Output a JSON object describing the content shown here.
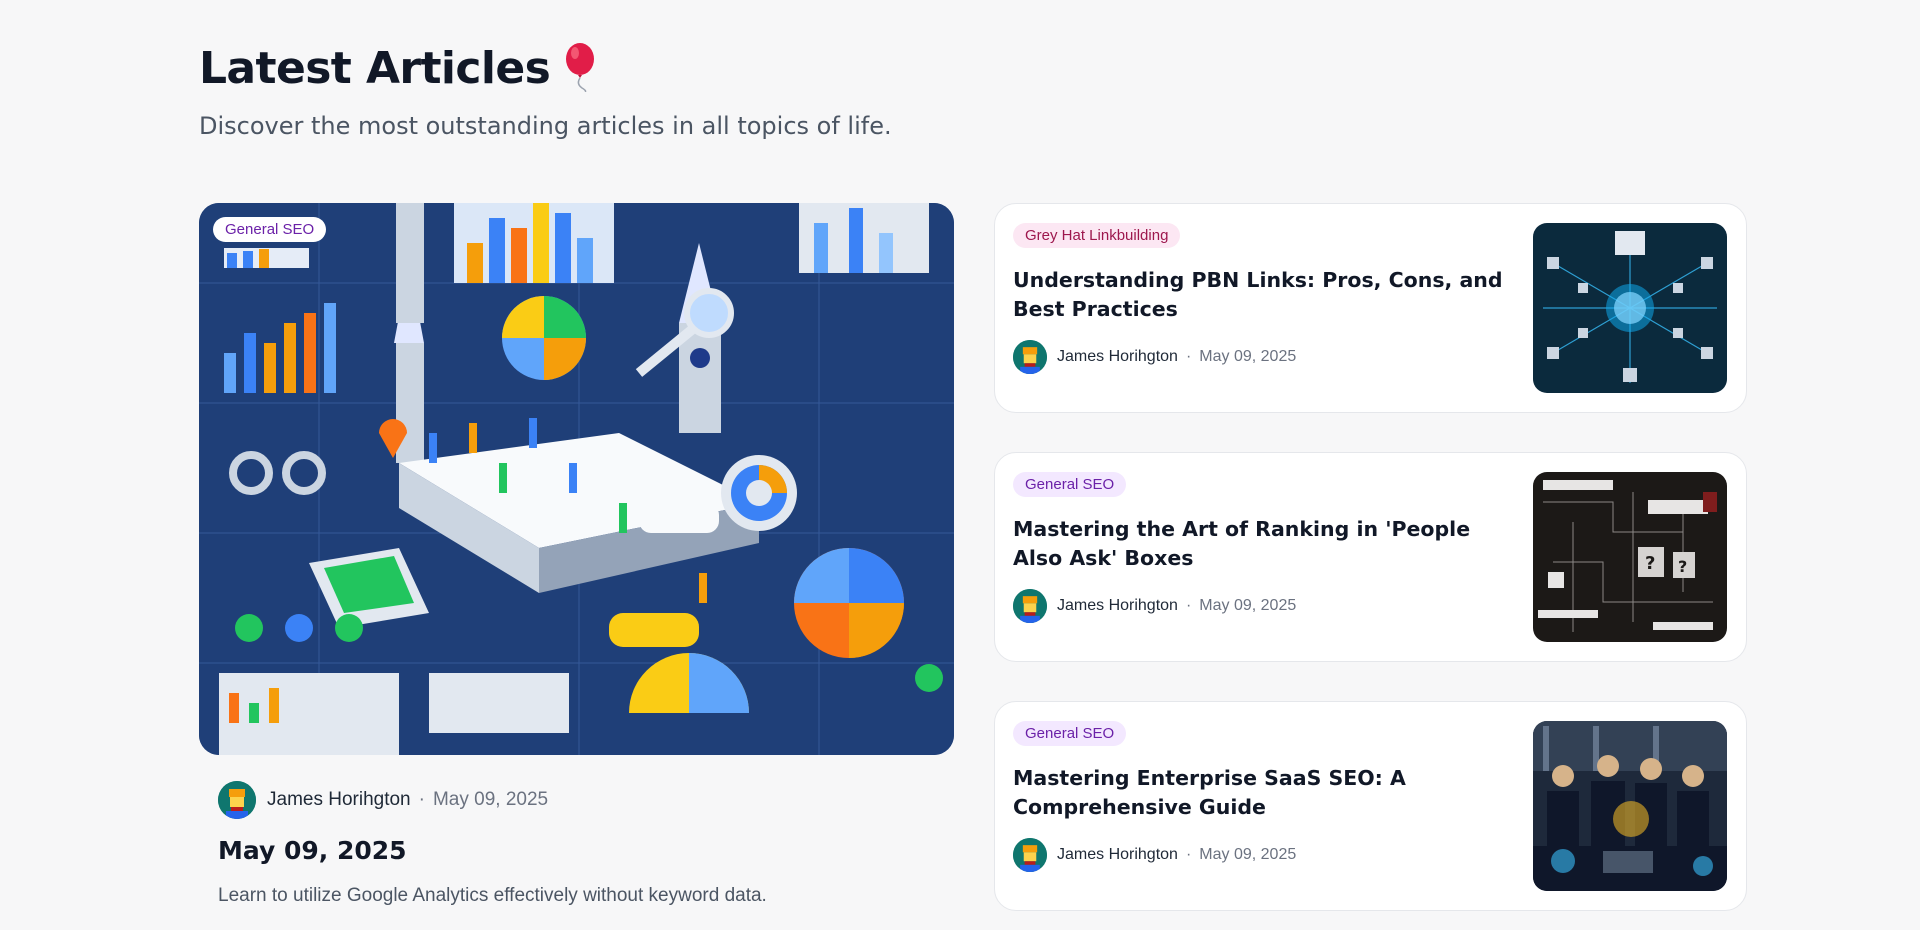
{
  "header": {
    "title": "Latest Articles",
    "subtitle": "Discover the most outstanding articles in all topics of life.",
    "emoji_icon": "balloon-icon"
  },
  "featured": {
    "category": "General SEO",
    "author": "James Horihgton",
    "date": "May 09, 2025",
    "title": "May 09, 2025",
    "description": "Learn to utilize Google Analytics effectively without keyword data.",
    "image_icon": "analytics-infographic-image"
  },
  "articles": [
    {
      "category": "Grey Hat Linkbuilding",
      "title": "Understanding PBN Links: Pros, Cons, and Best Practices",
      "author": "James Horihgton",
      "date": "May 09, 2025",
      "thumb": "network-cubes-image"
    },
    {
      "category": "General SEO",
      "title": "Mastering the Art of Ranking in 'People Also Ask' Boxes",
      "author": "James Horihgton",
      "date": "May 09, 2025",
      "thumb": "question-flowchart-image"
    },
    {
      "category": "General SEO",
      "title": "Mastering Enterprise SaaS SEO: A Comprehensive Guide",
      "author": "James Horihgton",
      "date": "May 09, 2025",
      "thumb": "team-meeting-image"
    }
  ],
  "meta_separator": "·",
  "colors": {
    "background": "#f7f7f8",
    "badge_purple_bg": "#f3e8ff",
    "badge_purple_text": "#6b21a8",
    "badge_pink_bg": "#fce7f3",
    "badge_pink_text": "#9d174d"
  }
}
